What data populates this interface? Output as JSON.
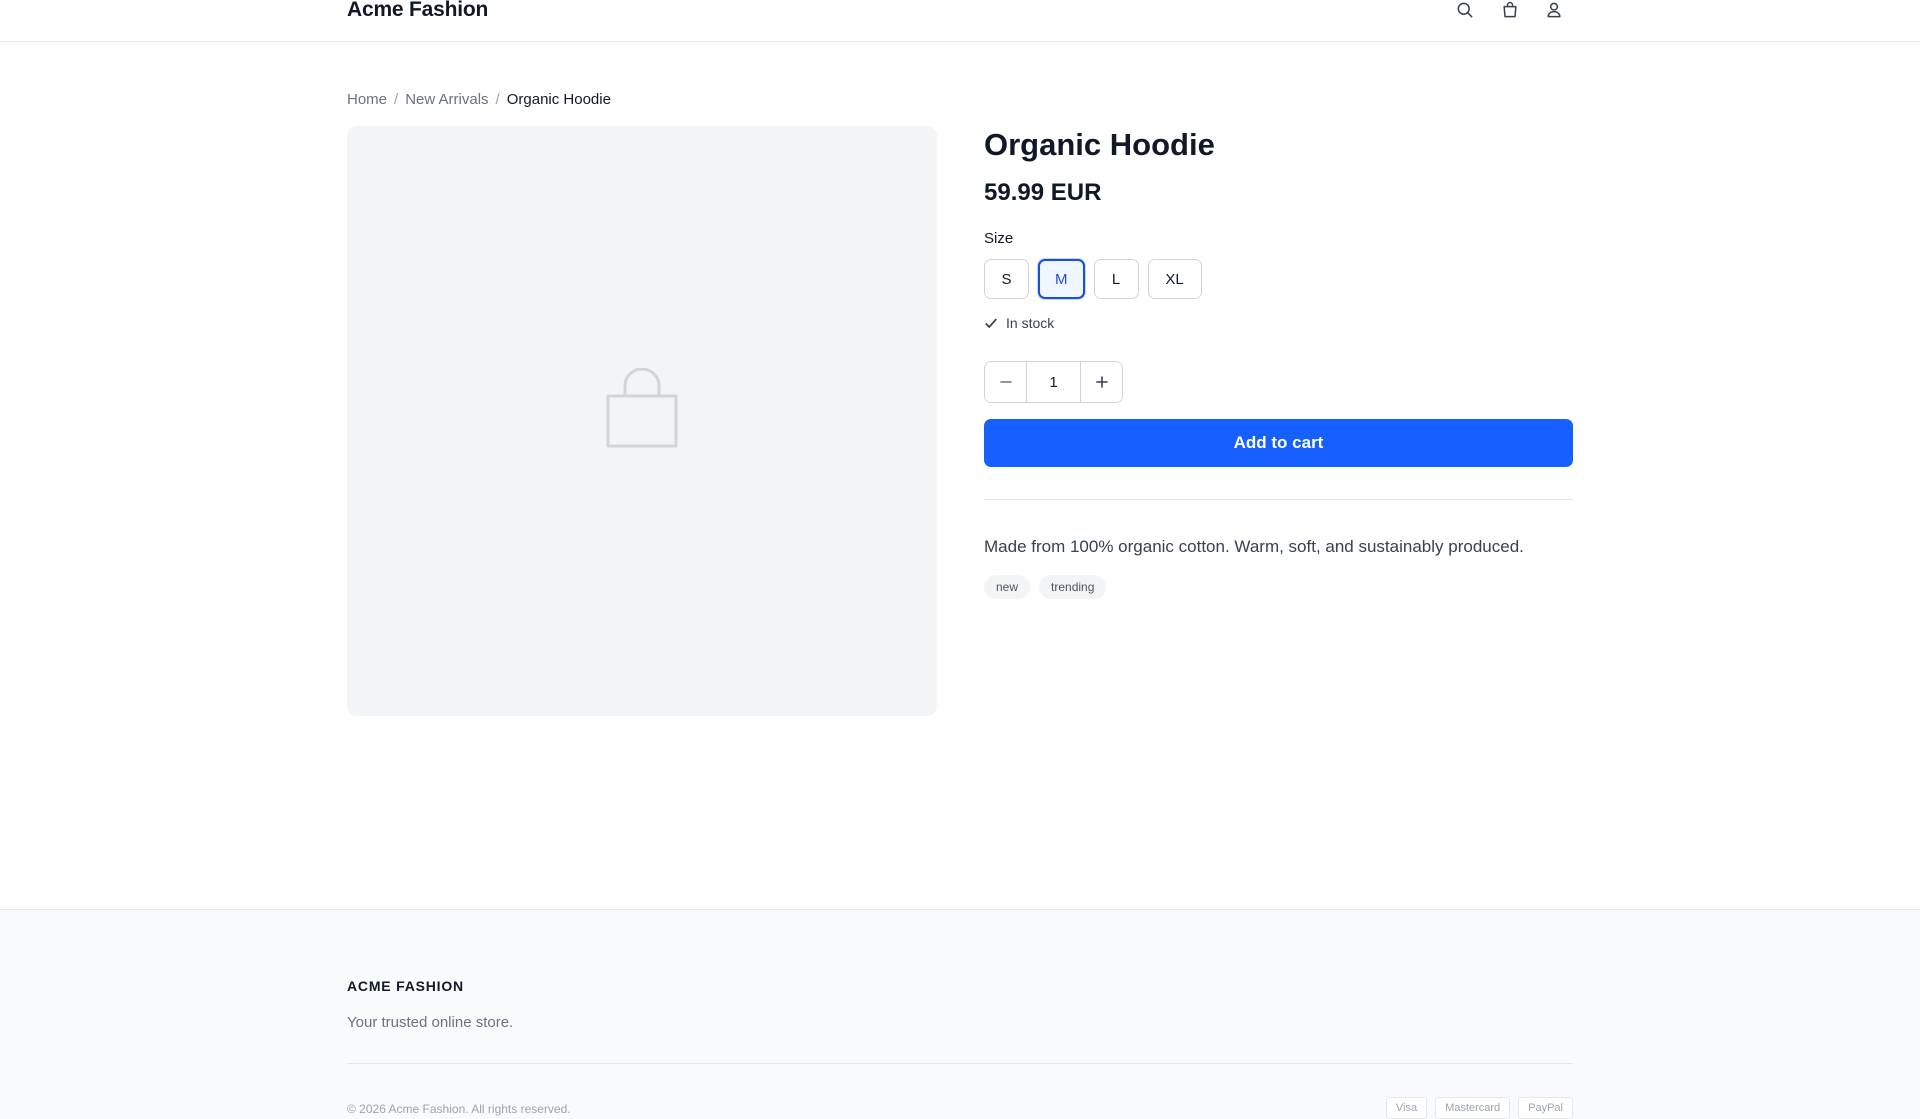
{
  "header": {
    "brand": "Acme Fashion",
    "icons": [
      "search-icon",
      "shopping-bag-icon",
      "user-icon"
    ]
  },
  "breadcrumb": {
    "items": [
      "Home",
      "New Arrivals"
    ],
    "current": "Organic Hoodie"
  },
  "product": {
    "image_icon": "shopping-bag-icon",
    "title": "Organic Hoodie",
    "price": "59.99 EUR",
    "size_label": "Size",
    "sizes": [
      "S",
      "M",
      "L",
      "XL"
    ],
    "selected_size": "M",
    "stock": "In stock",
    "quantity": "1",
    "add_to_cart": "Add to cart",
    "description": "Made from 100% organic cotton. Warm, soft, and sustainably produced.",
    "tags": [
      "new",
      "trending"
    ]
  },
  "footer": {
    "brand": "ACME FASHION",
    "tagline": "Your trusted online store.",
    "copyright": "© 2026 Acme Fashion. All rights reserved.",
    "payments": [
      "Visa",
      "Mastercard",
      "PayPal"
    ]
  },
  "colors": {
    "accent": "#1660ff",
    "selected_border": "#1d4ed8"
  }
}
